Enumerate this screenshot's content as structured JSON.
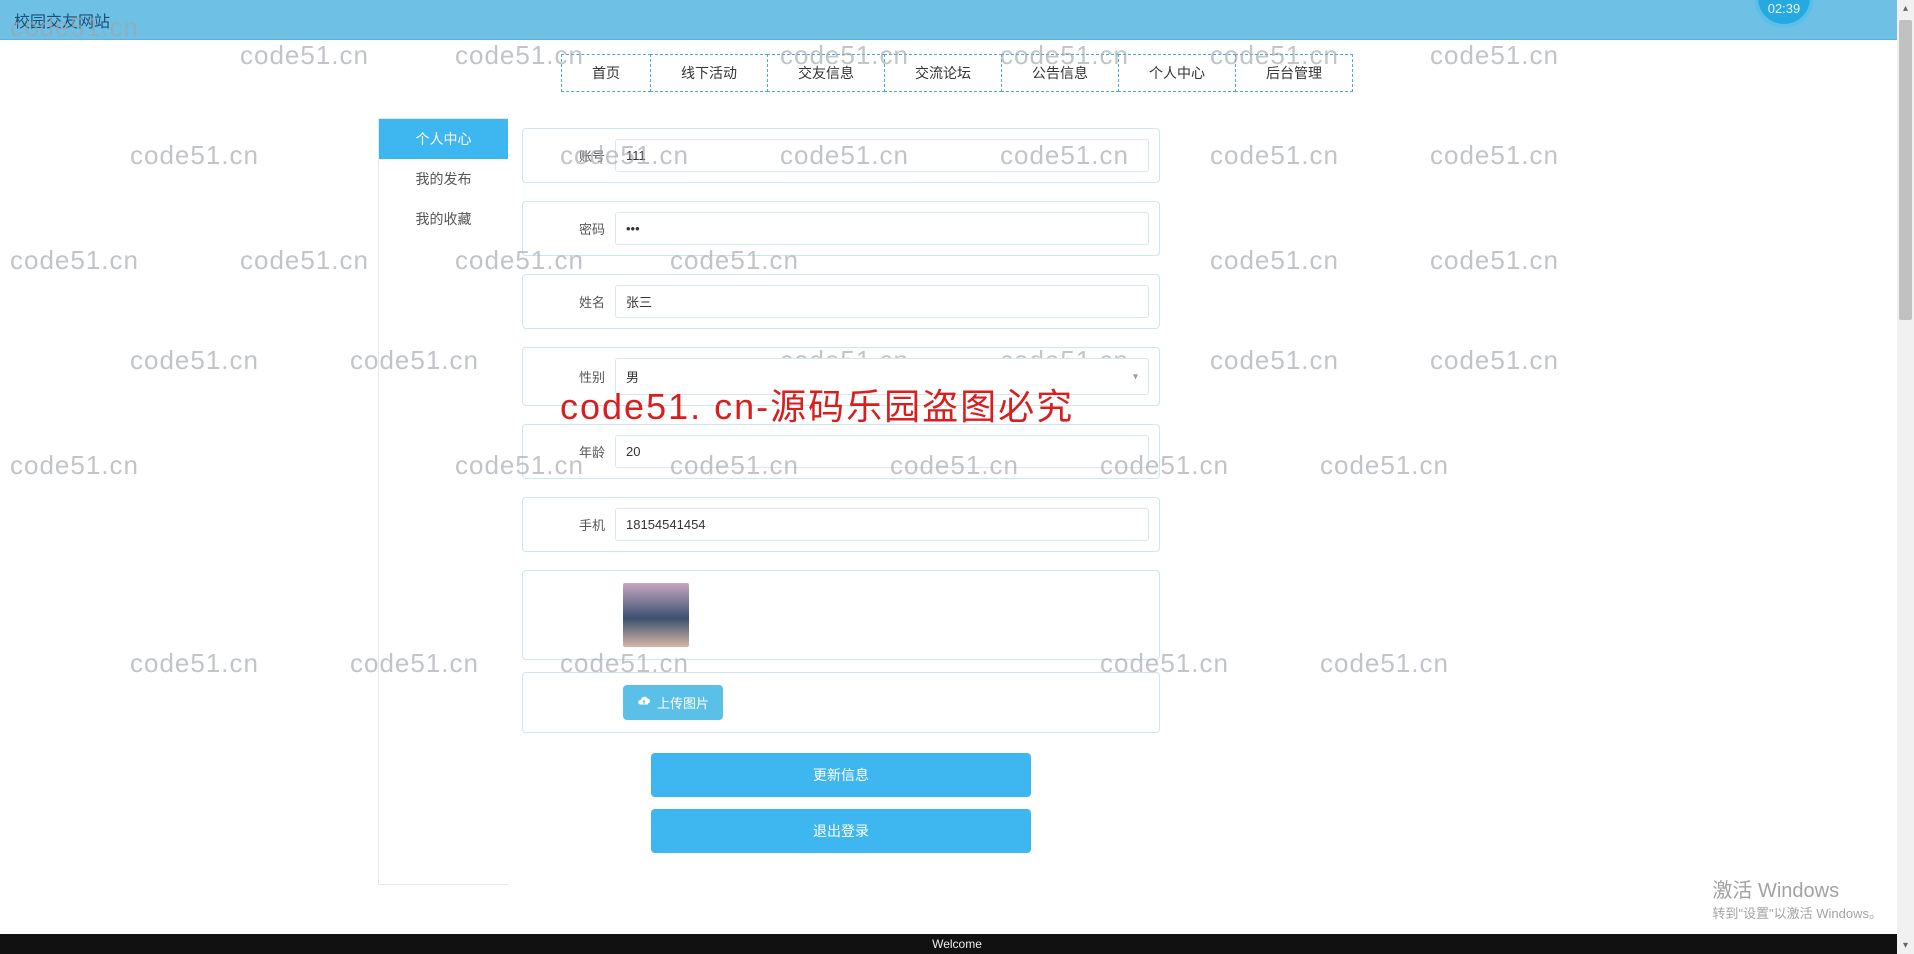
{
  "topbar": {
    "title": "校园交友网站",
    "badge": "02:39"
  },
  "nav": {
    "items": [
      "首页",
      "线下活动",
      "交友信息",
      "交流论坛",
      "公告信息",
      "个人中心",
      "后台管理"
    ]
  },
  "sidebar": {
    "items": [
      {
        "label": "个人中心",
        "active": true
      },
      {
        "label": "我的发布",
        "active": false
      },
      {
        "label": "我的收藏",
        "active": false
      }
    ]
  },
  "form": {
    "account": {
      "label": "账号",
      "value": "111"
    },
    "password": {
      "label": "密码",
      "value": "•••"
    },
    "name": {
      "label": "姓名",
      "value": "张三"
    },
    "gender": {
      "label": "性别",
      "value": "男"
    },
    "age": {
      "label": "年龄",
      "value": "20"
    },
    "phone": {
      "label": "手机",
      "value": "18154541454"
    }
  },
  "upload": {
    "button": "上传图片"
  },
  "actions": {
    "update": "更新信息",
    "logout": "退出登录"
  },
  "windows": {
    "line1": "激活 Windows",
    "line2": "转到\"设置\"以激活 Windows。"
  },
  "footer": {
    "text": "Welcome"
  },
  "watermark": {
    "text": "code51.cn",
    "big": "code51. cn-源码乐园盗图必究"
  }
}
